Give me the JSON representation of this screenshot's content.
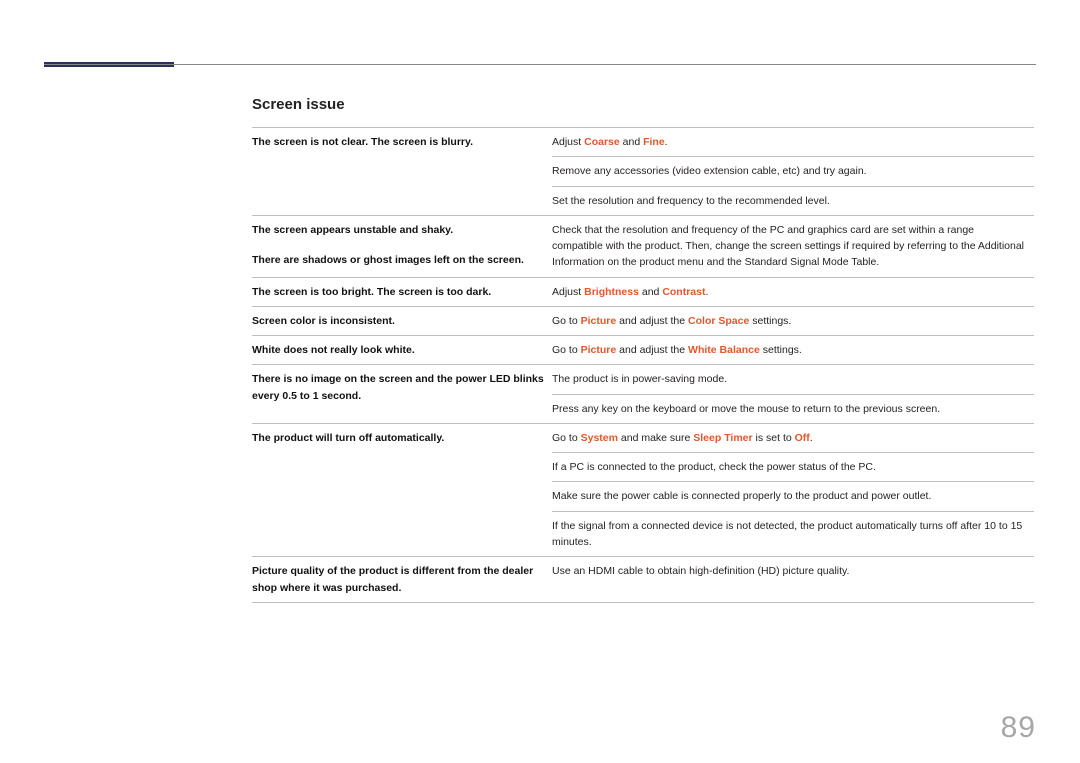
{
  "section_title": "Screen issue",
  "page_number": "89",
  "terms": {
    "coarse": "Coarse",
    "fine": "Fine",
    "brightness": "Brightness",
    "contrast": "Contrast",
    "picture": "Picture",
    "color_space": "Color Space",
    "white_balance": "White Balance",
    "system": "System",
    "sleep_timer": "Sleep Timer",
    "off": "Off"
  },
  "rows": [
    {
      "problem": "The screen is not clear. The screen is blurry.",
      "solutions": [
        {
          "pre": "Adjust ",
          "t1": "coarse",
          "mid": " and ",
          "t2": "fine",
          "post": "."
        },
        {
          "text": "Remove any accessories (video extension cable, etc) and try again."
        },
        {
          "text": "Set the resolution and frequency to the recommended level."
        }
      ]
    },
    {
      "problem": "The screen appears unstable and shaky.",
      "problem2": "There are shadows or ghost images left on the screen.",
      "solutions": [
        {
          "text": "Check that the resolution and frequency of the PC and graphics card are set within a range compatible with the product. Then, change the screen settings if required by referring to the Additional Information on the product menu and the Standard Signal Mode Table."
        }
      ]
    },
    {
      "problem": "The screen is too bright. The screen is too dark.",
      "solutions": [
        {
          "pre": "Adjust ",
          "t1": "brightness",
          "mid": " and ",
          "t2": "contrast",
          "post": "."
        }
      ]
    },
    {
      "problem": "Screen color is inconsistent.",
      "solutions": [
        {
          "pre": "Go to ",
          "t1": "picture",
          "mid": " and adjust the ",
          "t2": "color_space",
          "post": " settings."
        }
      ]
    },
    {
      "problem": "White does not really look white.",
      "solutions": [
        {
          "pre": "Go to ",
          "t1": "picture",
          "mid": " and adjust the ",
          "t2": "white_balance",
          "post": " settings."
        }
      ]
    },
    {
      "problem": "There is no image on the screen and the power LED blinks every 0.5 to 1 second.",
      "solutions": [
        {
          "text": "The product is in power-saving mode."
        },
        {
          "text": "Press any key on the keyboard or move the mouse to return to the previous screen."
        }
      ]
    },
    {
      "problem": "The product will turn off automatically.",
      "solutions": [
        {
          "pre": "Go to ",
          "t1": "system",
          "mid": " and make sure ",
          "t2": "sleep_timer",
          "mid2": " is set to ",
          "t3": "off",
          "post": "."
        },
        {
          "text": "If a PC is connected to the product, check the power status of the PC."
        },
        {
          "text": "Make sure the power cable is connected properly to the product and power outlet."
        },
        {
          "text": "If the signal from a connected device is not detected, the product automatically turns off after 10 to 15 minutes."
        }
      ]
    },
    {
      "problem": "Picture quality of the product is different from the dealer shop where it was purchased.",
      "solutions": [
        {
          "text": "Use an HDMI cable to obtain high-definition (HD) picture quality."
        }
      ]
    }
  ]
}
